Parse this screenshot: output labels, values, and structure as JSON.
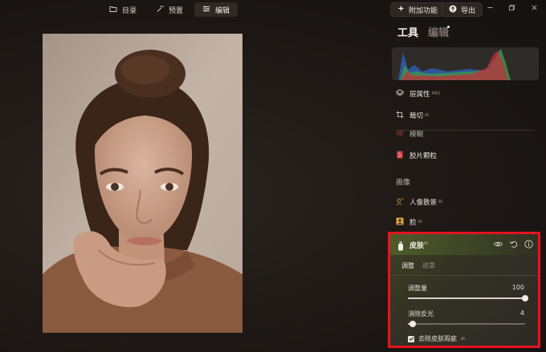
{
  "topnav": {
    "catalog_label": "目录",
    "presets_label": "预置",
    "edit_label": "编辑"
  },
  "toolbar": {
    "addons_label": "附加功能",
    "export_label": "导出"
  },
  "panel": {
    "tab_tools": "工具",
    "tab_edit": "编辑",
    "tools": [
      {
        "label": "层属性",
        "badge": "PRO"
      },
      {
        "label": "裁切",
        "badge": "AI"
      },
      {
        "label": "模糊",
        "badge": ""
      },
      {
        "label": "胶片颗粒",
        "badge": ""
      }
    ],
    "section_portrait": "画像",
    "portrait_tools": [
      {
        "label": "人像散景",
        "badge": "AI"
      },
      {
        "label": "脸",
        "badge": "AI"
      }
    ]
  },
  "skin": {
    "title": "皮肤",
    "badge": "AI",
    "tab_adjust": "调整",
    "tab_mask": "遮罩",
    "slider_amount_label": "调整量",
    "slider_amount_value": "100",
    "slider_amount_fraction": 1.0,
    "slider_shine_label": "消除反光",
    "slider_shine_value": "4",
    "slider_shine_fraction": 0.04,
    "checkbox_label": "去除皮肤瑕疵",
    "checkbox_badge": "AI",
    "checkbox_checked": true
  },
  "colors": {
    "highlight_border": "#e8121f",
    "accent_green": "#4f5a2b"
  }
}
